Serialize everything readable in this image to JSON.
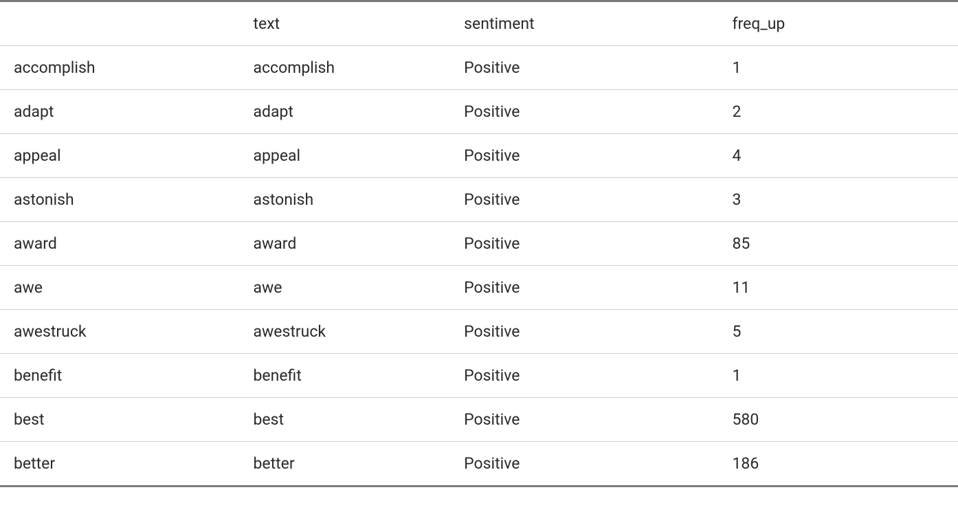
{
  "table": {
    "headers": {
      "rowhead": "",
      "text": "text",
      "sentiment": "sentiment",
      "freq_up": "freq_up"
    },
    "rows": [
      {
        "rowhead": "accomplish",
        "text": "accomplish",
        "sentiment": "Positive",
        "freq_up": "1"
      },
      {
        "rowhead": "adapt",
        "text": "adapt",
        "sentiment": "Positive",
        "freq_up": "2"
      },
      {
        "rowhead": "appeal",
        "text": "appeal",
        "sentiment": "Positive",
        "freq_up": "4"
      },
      {
        "rowhead": "astonish",
        "text": "astonish",
        "sentiment": "Positive",
        "freq_up": "3"
      },
      {
        "rowhead": "award",
        "text": "award",
        "sentiment": "Positive",
        "freq_up": "85"
      },
      {
        "rowhead": "awe",
        "text": "awe",
        "sentiment": "Positive",
        "freq_up": "11"
      },
      {
        "rowhead": "awestruck",
        "text": "awestruck",
        "sentiment": "Positive",
        "freq_up": "5"
      },
      {
        "rowhead": "benefit",
        "text": "benefit",
        "sentiment": "Positive",
        "freq_up": "1"
      },
      {
        "rowhead": "best",
        "text": "best",
        "sentiment": "Positive",
        "freq_up": "580"
      },
      {
        "rowhead": "better",
        "text": "better",
        "sentiment": "Positive",
        "freq_up": "186"
      }
    ]
  }
}
